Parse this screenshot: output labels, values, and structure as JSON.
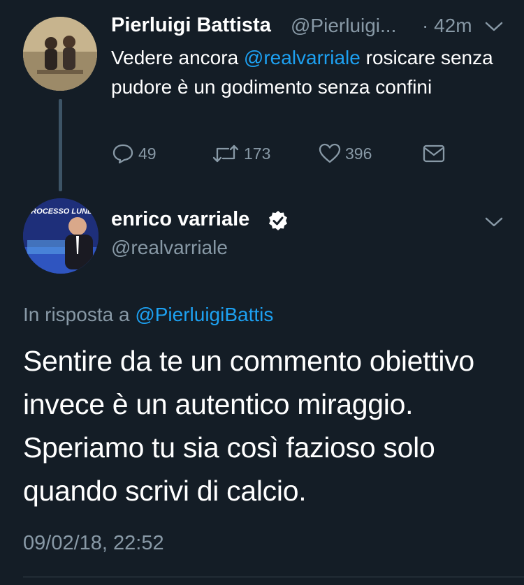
{
  "tweet1": {
    "author_name": "Pierluigi Battista",
    "author_handle": "@Pierluigi...",
    "time": "· 42m",
    "text_before": "Vedere ancora ",
    "mention": "@realvarriale",
    "text_after": " rosicare senza pudore è un godimento senza confini",
    "replies": "49",
    "retweets": "173",
    "likes": "396"
  },
  "tweet2": {
    "author_name": "enrico varriale",
    "author_handle": "@realvarriale",
    "reply_prefix": "In risposta a ",
    "reply_mention": "@PierluigiBattis",
    "text": "Sentire da te un commento obiettivo invece è un autentico miraggio. Speriamo tu sia così fazioso solo quando scrivi di calcio.",
    "timestamp": "09/02/18, 22:52",
    "avatar_logo": "PROCESSO LUNEDÌ"
  },
  "colors": {
    "background": "#141d26",
    "accent": "#1da1f2",
    "muted": "#8899a6",
    "thread_line": "#3d5466"
  }
}
